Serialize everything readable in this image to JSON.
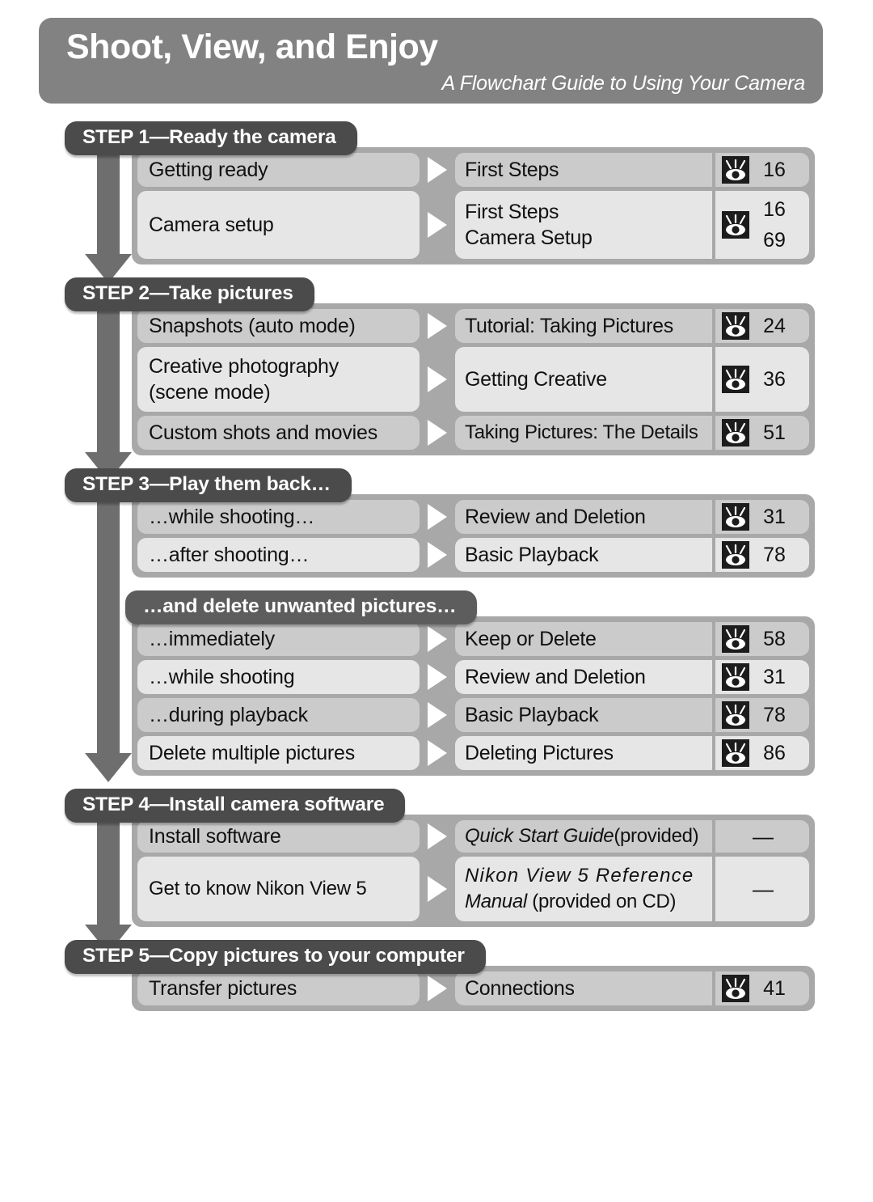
{
  "banner": {
    "title": "Shoot, View, and Enjoy",
    "subtitle": "A Flowchart Guide to Using Your Camera"
  },
  "icons": {
    "eye": "eye-icon",
    "arrow_down": "down-arrow-icon",
    "connector": "triangle-right-icon"
  },
  "colors": {
    "banner_bg": "#828282",
    "step_header_bg": "#4b4b4b",
    "sub_header_bg": "#5d5d5d",
    "table_bg": "#a8a8a8",
    "row_dark": "#cbcbcb",
    "row_light": "#e6e6e6",
    "arrow": "#6e6e6e",
    "text": "#111111",
    "header_text": "#ffffff"
  },
  "sections": [
    {
      "header": "STEP 1—Ready the camera",
      "rows": [
        {
          "task": "Getting ready",
          "ref": "First Steps",
          "pages": [
            "16"
          ],
          "has_icon": true
        },
        {
          "task": "Camera setup",
          "ref": "First Steps\nCamera Setup",
          "pages": [
            "16",
            "69"
          ],
          "has_icon": true
        }
      ]
    },
    {
      "header": "STEP 2—Take pictures",
      "rows": [
        {
          "task": "Snapshots (auto mode)",
          "ref": "Tutorial: Taking Pictures",
          "pages": [
            "24"
          ],
          "has_icon": true
        },
        {
          "task": "Creative photography (scene mode)",
          "ref": "Getting Creative",
          "pages": [
            "36"
          ],
          "has_icon": true
        },
        {
          "task": "Custom shots and movies",
          "ref": "Taking Pictures: The Details",
          "pages": [
            "51"
          ],
          "has_icon": true
        }
      ]
    },
    {
      "header": "STEP 3—Play them back…",
      "rows": [
        {
          "task": "…while shooting…",
          "ref": "Review and Deletion",
          "pages": [
            "31"
          ],
          "has_icon": true
        },
        {
          "task": "…after shooting…",
          "ref": "Basic Playback",
          "pages": [
            "78"
          ],
          "has_icon": true
        }
      ]
    },
    {
      "header": "…and delete unwanted pictures…",
      "is_sub": true,
      "rows": [
        {
          "task": "…immediately",
          "ref": "Keep or Delete",
          "pages": [
            "58"
          ],
          "has_icon": true
        },
        {
          "task": "…while shooting",
          "ref": "Review and Deletion",
          "pages": [
            "31"
          ],
          "has_icon": true
        },
        {
          "task": "…during playback",
          "ref": "Basic Playback",
          "pages": [
            "78"
          ],
          "has_icon": true
        },
        {
          "task": "Delete multiple pictures",
          "ref": "Deleting Pictures",
          "pages": [
            "86"
          ],
          "has_icon": true
        }
      ]
    },
    {
      "header": "STEP 4—Install camera software",
      "rows": [
        {
          "task": "Install software",
          "ref_italic": "Quick Start Guide",
          "ref_plain": " (provided)",
          "pages": [
            "—"
          ],
          "has_icon": false
        },
        {
          "task": "Get to know Nikon View 5",
          "ref_italic": "Nikon View 5 Reference",
          "ref_italic2": "Manual",
          "ref_plain": " (provided on CD)",
          "pages": [
            "—"
          ],
          "has_icon": false
        }
      ]
    },
    {
      "header": "STEP 5—Copy pictures to your computer",
      "rows": [
        {
          "task": "Transfer pictures",
          "ref": "Connections",
          "pages": [
            "41"
          ],
          "has_icon": true
        }
      ]
    }
  ]
}
